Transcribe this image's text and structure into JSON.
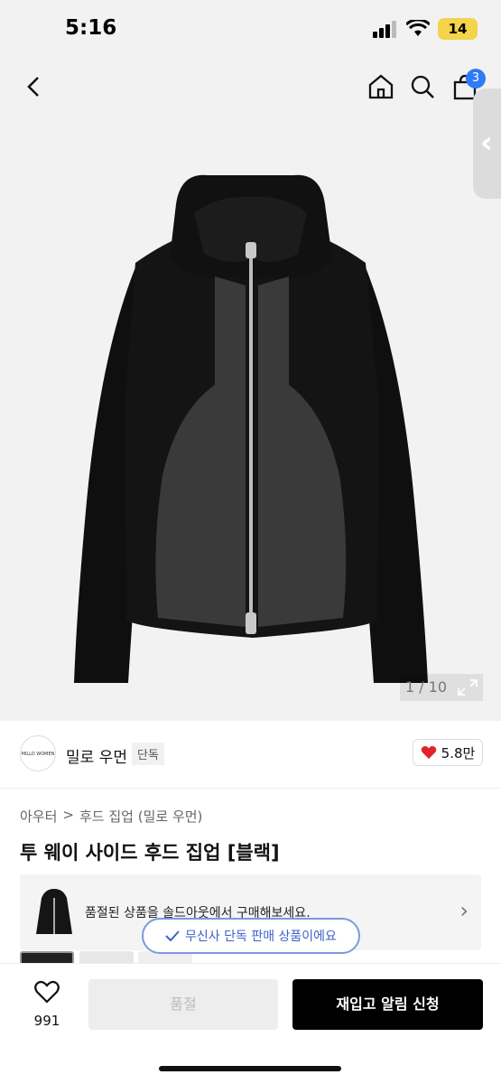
{
  "status": {
    "time": "5:16",
    "battery": "14"
  },
  "nav": {
    "cart_count": "3"
  },
  "gallery": {
    "counter": "1 / 10"
  },
  "brand": {
    "logo_text": "MILLO WOMEN",
    "name": "밀로 우먼",
    "tag": "단독",
    "likes": "5.8만"
  },
  "breadcrumb": {
    "category": "아우터",
    "separator": ">",
    "sub": "후드 집업 (밀로 우먼)"
  },
  "product": {
    "title": "투 웨이 사이드 후드 집업 [블랙]"
  },
  "soldout_notice": {
    "text": "품절된 상품을 솔드아웃에서 구매해보세요."
  },
  "toast": {
    "text": "무신사 단독 판매 상품이에요"
  },
  "bottom": {
    "wish_count": "991",
    "soldout_label": "품절",
    "restock_label": "재입고 알림 신청"
  },
  "colors": {
    "accent": "#2f7af6",
    "heart": "#e0242b",
    "toast": "#3e62c7"
  }
}
